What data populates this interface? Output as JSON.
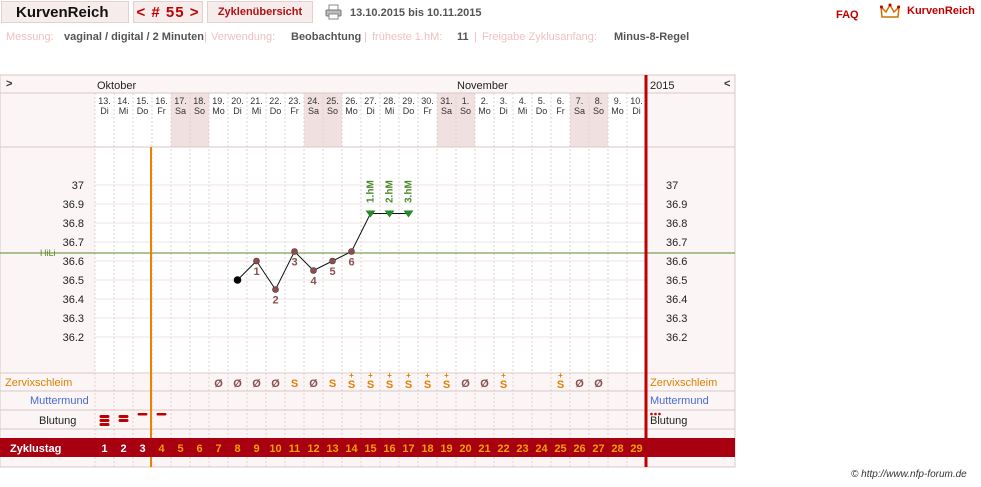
{
  "app": {
    "title": "KurvenReich",
    "cycle_number": "< # 55 >",
    "cycle_overview": "Zyklenübersicht",
    "date_range": "13.10.2015 bis 10.11.2015",
    "faq": "FAQ",
    "logo_text": "KurvenReich"
  },
  "info": {
    "messung_label": "Messung:",
    "messung_value": "vaginal / digital / 2 Minuten",
    "verwendung_label": "Verwendung:",
    "verwendung_value": "Beobachtung",
    "hm_label": "früheste 1.hM:",
    "hm_value": "11",
    "freigabe_label": "Freigabe Zyklusanfang:",
    "freigabe_value": "Minus-8-Regel"
  },
  "chart": {
    "nav_left": ">",
    "nav_right": "<",
    "month_oktober": "Oktober",
    "month_november": "November",
    "year": "2015",
    "dates": [
      "13.",
      "14.",
      "15.",
      "16.",
      "17.",
      "18.",
      "19.",
      "20.",
      "21.",
      "22.",
      "23.",
      "24.",
      "25.",
      "26.",
      "27.",
      "28.",
      "29.",
      "30.",
      "31.",
      "1.",
      "2.",
      "3.",
      "4.",
      "5.",
      "6.",
      "7.",
      "8.",
      "9.",
      "10."
    ],
    "weekdays": [
      "Di",
      "Mi",
      "Do",
      "Fr",
      "Sa",
      "So",
      "Mo",
      "Di",
      "Mi",
      "Do",
      "Fr",
      "Sa",
      "So",
      "Mo",
      "Di",
      "Mi",
      "Do",
      "Fr",
      "Sa",
      "So",
      "Mo",
      "Di",
      "Mi",
      "Do",
      "Fr",
      "Sa",
      "So",
      "Mo",
      "Di"
    ],
    "y_ticks": [
      "37",
      "36.9",
      "36.8",
      "36.7",
      "36.6",
      "36.5",
      "36.4",
      "36.3",
      "36.2"
    ],
    "hili_label": "HiLi",
    "row_labels": {
      "zervix": "Zervixschleim",
      "muttermund": "Muttermund",
      "blutung": "Blutung",
      "zyklustag": "Zyklustag"
    },
    "cycle_days": [
      "1",
      "2",
      "3",
      "4",
      "5",
      "6",
      "7",
      "8",
      "9",
      "10",
      "11",
      "12",
      "13",
      "14",
      "15",
      "16",
      "17",
      "18",
      "19",
      "20",
      "21",
      "22",
      "23",
      "24",
      "25",
      "26",
      "27",
      "28",
      "29"
    ],
    "mucus": [
      "",
      "",
      "",
      "",
      "",
      "",
      "Ø",
      "Ø",
      "Ø",
      "Ø",
      "S",
      "Ø",
      "S",
      "S+",
      "S+",
      "S+",
      "S+",
      "S+",
      "S+",
      "Ø",
      "Ø",
      "S+",
      "",
      "",
      "S+",
      "Ø",
      "Ø",
      "",
      ""
    ],
    "bleeding": [
      "heavy",
      "medium",
      "light",
      "light",
      "",
      "",
      "",
      "",
      "",
      "",
      "",
      "",
      "",
      "",
      "",
      "",
      "",
      "",
      "",
      "",
      "",
      "",
      "",
      "",
      "",
      "",
      "",
      "",
      "",
      "spotting"
    ],
    "hm_labels": [
      "1.hM",
      "2.hM",
      "3.hM"
    ],
    "colors": {
      "accent": "#c00000",
      "orange": "#f08000",
      "hili": "#5a8a2a",
      "temp_dot": "#8a5050",
      "mucus": "#e08000",
      "hm": "#4a8a2a",
      "shade": "#f0e0e0"
    }
  },
  "chart_data": {
    "type": "line",
    "title": "",
    "xlabel": "Zyklustag",
    "ylabel": "",
    "x": [
      8,
      9,
      10,
      11,
      12,
      13,
      14,
      15,
      16,
      17
    ],
    "values": [
      36.5,
      36.6,
      36.45,
      36.65,
      36.55,
      36.6,
      36.65,
      36.85,
      36.85,
      36.85
    ],
    "point_labels": [
      "",
      "1",
      "2",
      "3",
      "4",
      "5",
      "6",
      "",
      "",
      ""
    ],
    "ylim": [
      36.1,
      37.1
    ],
    "hili": 36.65,
    "grid": true
  },
  "footer": {
    "copyright": "© http://www.nfp-forum.de"
  }
}
